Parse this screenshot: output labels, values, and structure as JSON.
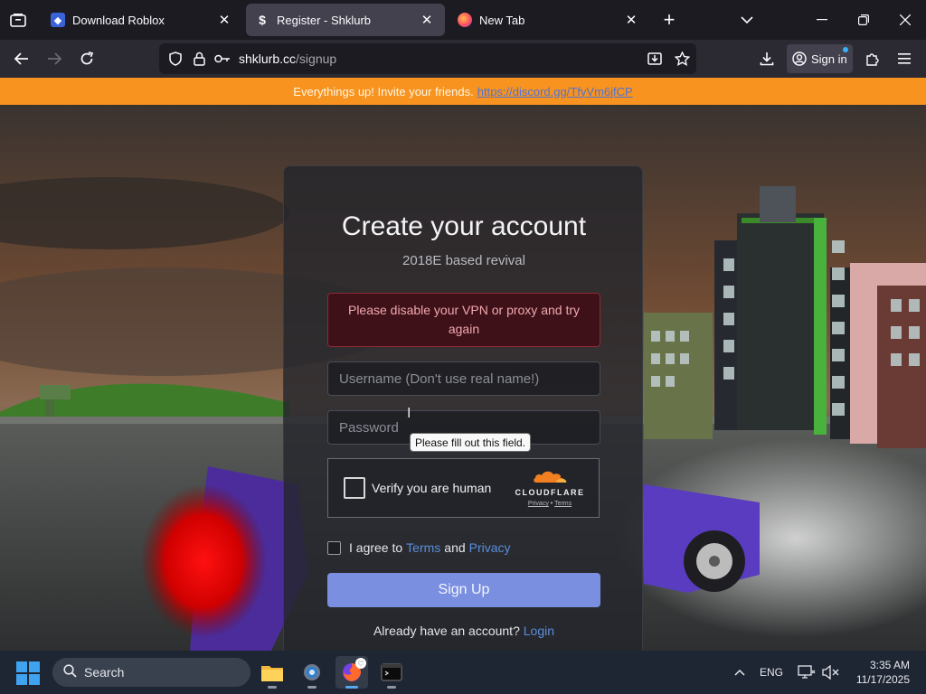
{
  "browser": {
    "tabs": [
      {
        "title": "Download Roblox",
        "active": false
      },
      {
        "title": "Register - Shklurb",
        "active": true
      },
      {
        "title": "New Tab",
        "active": false
      }
    ],
    "url_host": "shklurb.cc",
    "url_path": "/signup",
    "signin_label": "Sign in"
  },
  "notice": {
    "text": "Everythings up! Invite your friends.",
    "link": "https://discord.gg/TfyVm6jfCP"
  },
  "form": {
    "title": "Create your account",
    "subtitle": "2018E based revival",
    "error": "Please disable your VPN or proxy and try again",
    "username_placeholder": "Username (Don't use real name!)",
    "password_placeholder": "Password",
    "tooltip": "Please fill out this field.",
    "captcha_label": "Verify you are human",
    "captcha_brand": "CLOUDFLARE",
    "captcha_privacy": "Privacy",
    "captcha_sep": "•",
    "captcha_terms": "Terms",
    "agree_prefix": "I agree to",
    "agree_terms": "Terms",
    "agree_and": "and",
    "agree_privacy": "Privacy",
    "signup_label": "Sign Up",
    "login_prompt": "Already have an account?",
    "login_link": "Login"
  },
  "taskbar": {
    "search_label": "Search",
    "language": "ENG",
    "time": "3:35 AM",
    "date": "11/17/2025"
  },
  "colors": {
    "notice_bg": "#f7931e",
    "accent_button": "#7a8fdf",
    "link": "#5b8ddc",
    "error_bg": "#3e1118"
  }
}
